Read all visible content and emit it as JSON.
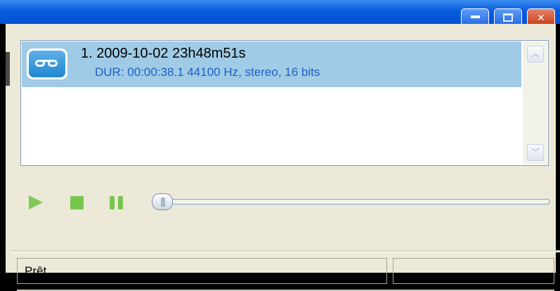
{
  "window": {
    "title_buttons": {
      "minimize_icon": "minimize-icon",
      "maximize_icon": "maximize-icon",
      "close_icon": "close-icon",
      "close_glyph": "✕"
    }
  },
  "playlist": {
    "tracks": [
      {
        "title": "1. 2009-10-02 23h48m51s",
        "info": "DUR: 00:00:38.1   44100 Hz, stereo, 16 bits",
        "icon": "tape-icon",
        "selected": true
      }
    ],
    "scroll_up_glyph": "︿",
    "scroll_down_glyph": "﹀"
  },
  "controls": {
    "play_icon": "play-icon",
    "stop_icon": "stop-icon",
    "pause_icon": "pause-icon",
    "seek_position": 0.0
  },
  "status_bar": {
    "text": "Prêt",
    "secondary": ""
  },
  "colors": {
    "title_bar": "#0a5ce0",
    "selection": "#9fcbe6",
    "control_green": "#76c64e",
    "info_text": "#1f5fc4"
  }
}
